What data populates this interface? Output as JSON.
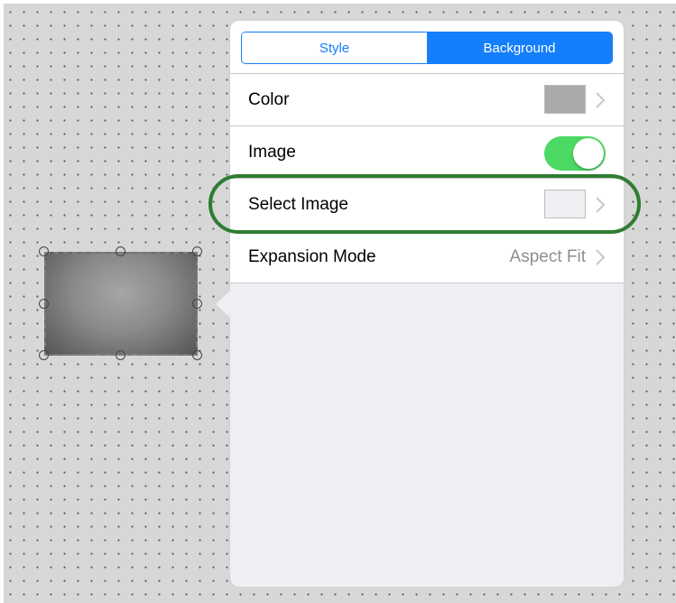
{
  "segmented": {
    "tabs": [
      {
        "label": "Style",
        "active": false
      },
      {
        "label": "Background",
        "active": true
      }
    ]
  },
  "rows": {
    "color": {
      "label": "Color",
      "swatch_color": "#a9a9a9"
    },
    "image": {
      "label": "Image",
      "toggle_on": true
    },
    "select_image": {
      "label": "Select Image",
      "swatch_color": "#efeff4"
    },
    "expansion_mode": {
      "label": "Expansion Mode",
      "value": "Aspect Fit"
    }
  },
  "colors": {
    "accent": "#147efb",
    "toggle_on": "#4cd964",
    "highlight_ring": "#2e7d32",
    "canvas_bg": "#d7d7d7"
  },
  "icons": {
    "chevron": "chevron-right-icon"
  }
}
